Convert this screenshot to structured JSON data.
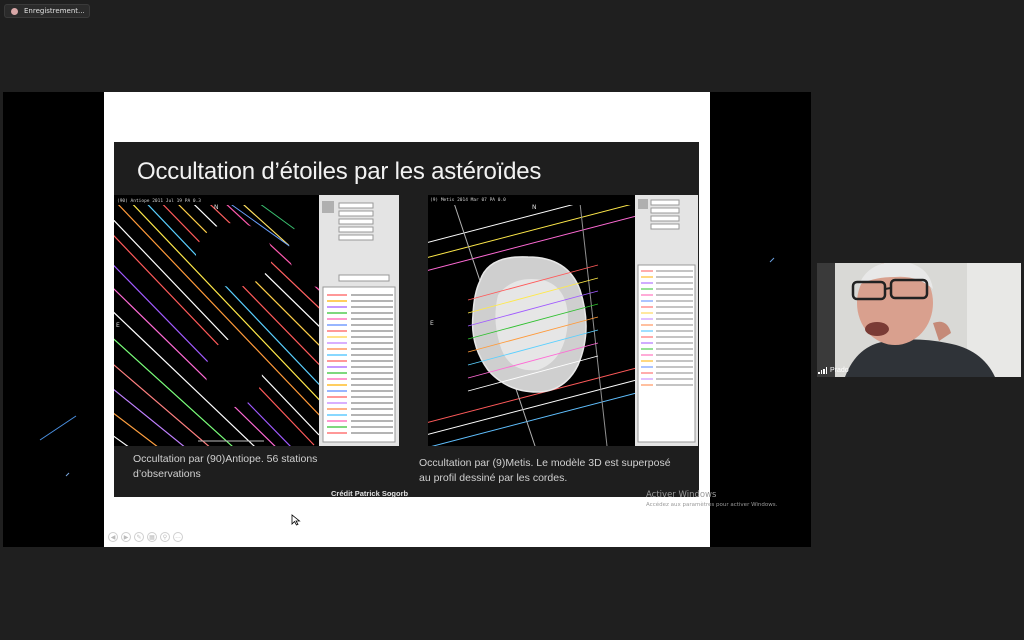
{
  "recording": {
    "label": "Enregistrement..."
  },
  "slide": {
    "title": "Occultation d’étoiles par les astéroïdes",
    "caption_left_line1": "Occultation par (90)Antiope. 56 stations",
    "caption_left_line2": "d’observations",
    "caption_right_line1": "Occultation par (9)Metis. Le modèle 3D est superposé",
    "caption_right_line2": "au profil dessiné par les cordes.",
    "credit": "Crédit Patrick Sogorb",
    "left_panel_n": "N",
    "left_panel_e": "E",
    "right_panel_n": "N",
    "right_panel_e": "E"
  },
  "watermark": {
    "title": "Activer Windows",
    "subtitle": "Accédez aux paramètres pour activer Windows."
  },
  "participant": {
    "name": "Prado"
  },
  "colors": {
    "background": "#1f1f1f",
    "slide_dark": "#1e1e1e",
    "accent_red": "#e04040"
  }
}
